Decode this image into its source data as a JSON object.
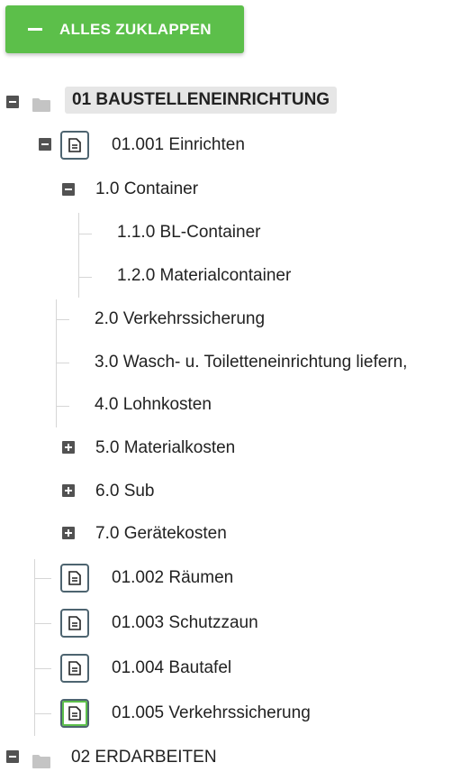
{
  "toolbar": {
    "collapse_all_label": "ALLES ZUKLAPPEN"
  },
  "tree": {
    "root1": {
      "label": "01 BAUSTELLENEINRICHTUNG",
      "children": {
        "item_001": {
          "label": "01.001 Einrichten",
          "children": {
            "c1": {
              "label": "1.0 Container",
              "children": [
                "1.1.0 BL-Container",
                "1.2.0 Materialcontainer"
              ]
            },
            "c2": "2.0 Verkehrssicherung",
            "c3": "3.0 Wasch- u. Toiletteneinrichtung liefern,",
            "c4": "4.0 Lohnkosten",
            "c5": "5.0 Materialkosten",
            "c6": "6.0 Sub",
            "c7": "7.0 Gerätekosten"
          }
        },
        "item_002": "01.002 Räumen",
        "item_003": "01.003 Schutzzaun",
        "item_004": "01.004 Bautafel",
        "item_005": "01.005 Verkehrssicherung"
      }
    },
    "root2": {
      "label": "02 ERDARBEITEN"
    }
  },
  "icons": {
    "collapse": "minus-box-icon",
    "expand": "plus-box-icon",
    "folder": "folder-icon",
    "document": "document-icon"
  },
  "colors": {
    "accent": "#5cbf4a",
    "icon_dark": "#525252",
    "doc_border": "#4d6470",
    "highlight_bg": "#e6e6e6"
  }
}
